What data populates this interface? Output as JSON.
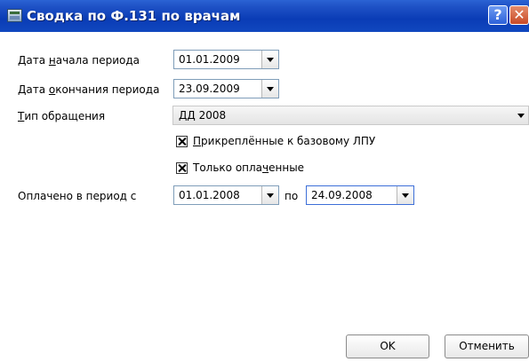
{
  "window": {
    "title": "Сводка по Ф.131 по врачам",
    "help_glyph": "?",
    "close_glyph": "✕"
  },
  "form": {
    "start_date": {
      "label_pre": "Дата ",
      "label_ul": "н",
      "label_post": "ачала периода",
      "value": "01.01.2009"
    },
    "end_date": {
      "label_pre": "Дата ",
      "label_ul": "о",
      "label_post": "кончания периода",
      "value": "23.09.2009"
    },
    "appeal_type": {
      "label_ul": "Т",
      "label_post": "ип обращения",
      "value": "ДД 2008"
    },
    "attached_checkbox": {
      "label_ul": "П",
      "label_post": "рикреплённые к базовому ЛПУ",
      "checked": true
    },
    "paid_only_checkbox": {
      "label_pre": "Только опла",
      "label_ul": "ч",
      "label_post": "енные",
      "checked": true
    },
    "paid_period": {
      "label": "Оплачено в период с",
      "from": "01.01.2008",
      "to_label": "по",
      "to": "24.09.2008"
    }
  },
  "buttons": {
    "ok": "OK",
    "cancel": "Отменить"
  }
}
